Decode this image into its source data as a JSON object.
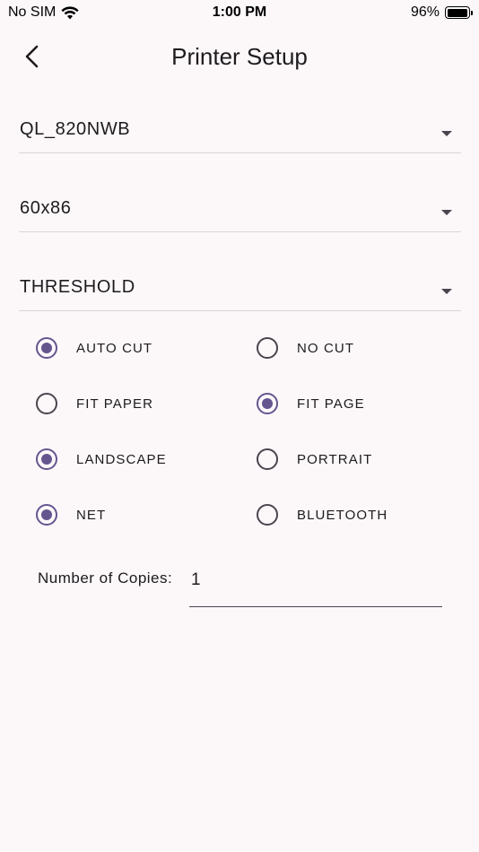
{
  "status_bar": {
    "carrier": "No SIM",
    "time": "1:00 PM",
    "battery": "96%",
    "battery_level": 0.96
  },
  "header": {
    "title": "Printer Setup",
    "back_icon": "chevron-left-icon"
  },
  "dropdowns": {
    "printer_model": "QL_820NWB",
    "label_size": "60x86",
    "print_mode": "THRESHOLD"
  },
  "options": {
    "auto_cut": {
      "label": "AUTO CUT",
      "checked": true
    },
    "no_cut": {
      "label": "NO CUT",
      "checked": false
    },
    "fit_paper": {
      "label": "FIT PAPER",
      "checked": false
    },
    "fit_page": {
      "label": "FIT PAGE",
      "checked": true
    },
    "landscape": {
      "label": "LANDSCAPE",
      "checked": true
    },
    "portrait": {
      "label": "PORTRAIT",
      "checked": false
    },
    "net": {
      "label": "NET",
      "checked": true
    },
    "bluetooth": {
      "label": "BLUETOOTH",
      "checked": false
    }
  },
  "copies": {
    "label": "Number of Copies:",
    "value": "1"
  },
  "colors": {
    "accent": "#65558f",
    "background": "#fcf8fa",
    "text": "#1d1b1e"
  }
}
